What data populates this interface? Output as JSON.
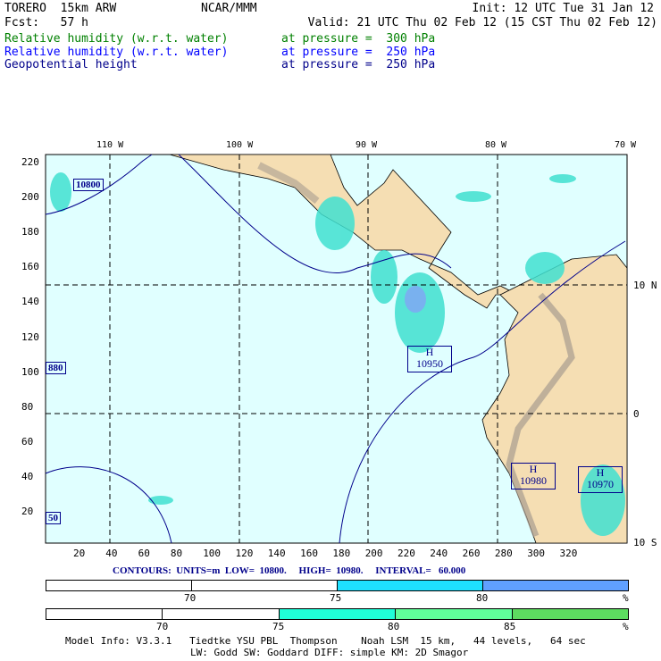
{
  "header": {
    "model": "TORERO  15km ARW",
    "org": "NCAR/MMM",
    "init": "Init: 12 UTC Tue 31 Jan 12",
    "fcst": "Fcst:   57 h",
    "valid": "Valid: 21 UTC Thu 02 Feb 12 (15 CST Thu 02 Feb 12)"
  },
  "fields": [
    {
      "name": "Relative humidity (w.r.t. water)",
      "level": "at pressure =  300 hPa",
      "color": "#008000"
    },
    {
      "name": "Relative humidity (w.r.t. water)",
      "level": "at pressure =  250 hPa",
      "color": "#0000ff"
    },
    {
      "name": "Geopotential height",
      "level": "at pressure =  250 hPa",
      "color": "#00008b"
    }
  ],
  "map": {
    "top_lon_labels": [
      "110 W",
      "100 W",
      "90 W",
      "80 W",
      "70 W"
    ],
    "right_lat_labels": [
      "10 N",
      "0",
      "10 S"
    ],
    "left_ticks": [
      "220",
      "200",
      "180",
      "160",
      "140",
      "120",
      "100",
      "80",
      "60",
      "40",
      "20"
    ],
    "bottom_ticks": [
      "20",
      "40",
      "60",
      "80",
      "100",
      "120",
      "140",
      "160",
      "180",
      "200",
      "220",
      "240",
      "260",
      "280",
      "300",
      "320"
    ],
    "contour_labels": [
      "10800",
      "880",
      "50"
    ],
    "highs": [
      {
        "h": "H",
        "v": "10950"
      },
      {
        "h": "H",
        "v": "10980"
      },
      {
        "h": "H",
        "v": "10970"
      }
    ]
  },
  "contours": {
    "text": "CONTOURS:  UNITS=m  LOW=  10800.     HIGH=  10980.     INTERVAL=   60.000"
  },
  "legend1": {
    "labels": [
      "70",
      "75",
      "80",
      "%"
    ],
    "colors": [
      "#ffffff",
      "#ffffff",
      "#1ee0ff",
      "#60a0ff"
    ]
  },
  "legend2": {
    "labels": [
      "70",
      "75",
      "80",
      "85",
      "%"
    ],
    "colors": [
      "#ffffff",
      "#ffffff",
      "#20ffd8",
      "#60ff9a",
      "#5ddc60"
    ]
  },
  "footer": {
    "line1": "Model Info: V3.3.1   Tiedtke YSU PBL  Thompson    Noah LSM  15 km,   44 levels,   64 sec",
    "line2": "LW: Godd SW: Goddard DIFF: simple KM: 2D Smagor"
  }
}
